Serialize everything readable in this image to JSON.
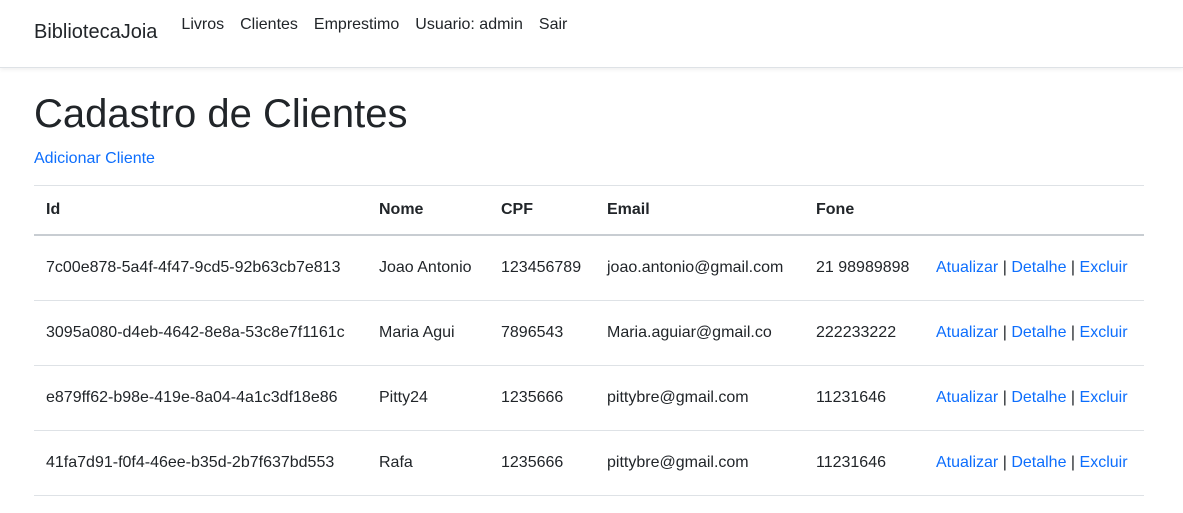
{
  "navbar": {
    "brand": "BibliotecaJoia",
    "links": [
      "Livros",
      "Clientes",
      "Emprestimo",
      "Usuario: admin",
      "Sair"
    ]
  },
  "page": {
    "title": "Cadastro de Clientes",
    "add_link": "Adicionar Cliente"
  },
  "table": {
    "headers": [
      "Id",
      "Nome",
      "CPF",
      "Email",
      "Fone"
    ],
    "rows": [
      {
        "id": "7c00e878-5a4f-4f47-9cd5-92b63cb7e813",
        "nome": "Joao Antonio",
        "cpf": "123456789",
        "email": "joao.antonio@gmail.com",
        "fone": "21 98989898"
      },
      {
        "id": "3095a080-d4eb-4642-8e8a-53c8e7f1161c",
        "nome": "Maria Agui",
        "cpf": "7896543",
        "email": "Maria.aguiar@gmail.co",
        "fone": "222233222"
      },
      {
        "id": "e879ff62-b98e-419e-8a04-4a1c3df18e86",
        "nome": "Pitty24",
        "cpf": "1235666",
        "email": "pittybre@gmail.com",
        "fone": "11231646"
      },
      {
        "id": "41fa7d91-f0f4-46ee-b35d-2b7f637bd553",
        "nome": "Rafa",
        "cpf": "1235666",
        "email": "pittybre@gmail.com",
        "fone": "11231646"
      }
    ],
    "actions": {
      "update": "Atualizar",
      "detail": "Detalhe",
      "delete": "Excluir",
      "separator": "|"
    }
  },
  "colors": {
    "link": "#0d6efd",
    "text": "#212529",
    "border": "#dee2e6"
  }
}
